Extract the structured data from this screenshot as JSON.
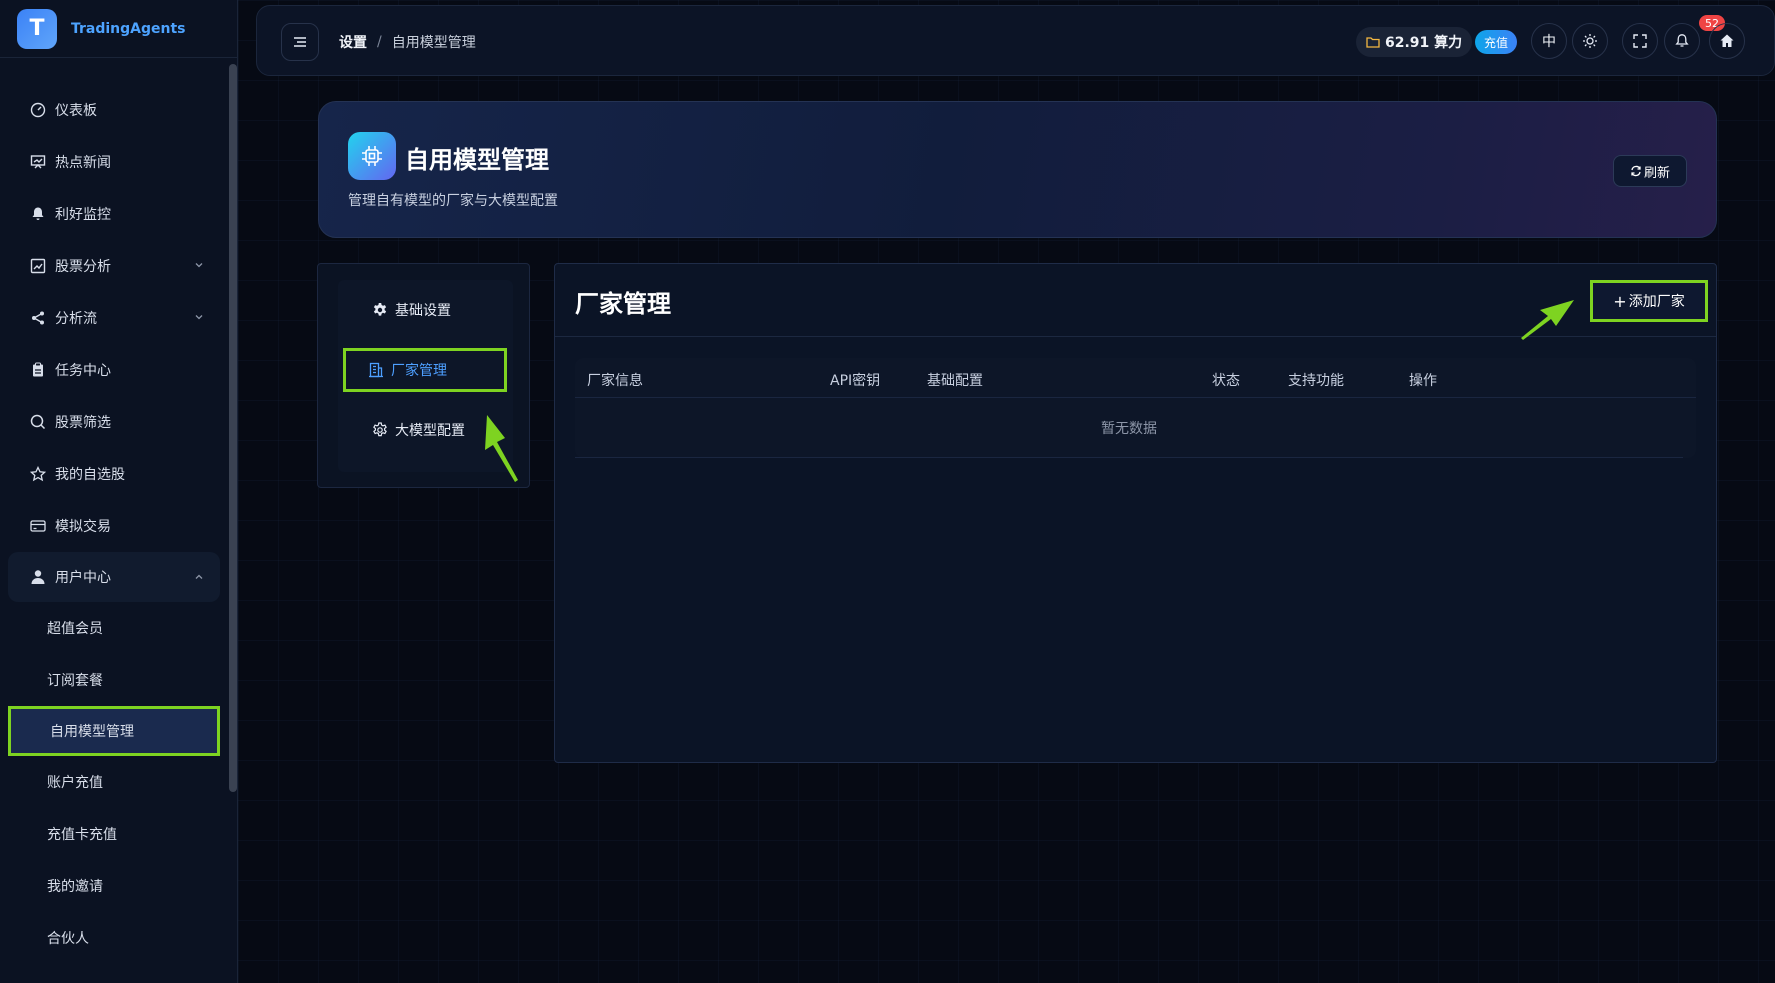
{
  "app": {
    "name": "TradingAgents",
    "logo_letter": "T"
  },
  "sidebar": {
    "items": [
      {
        "label": "仪表板",
        "icon": "gauge-icon"
      },
      {
        "label": "热点新闻",
        "icon": "presentation-icon"
      },
      {
        "label": "利好监控",
        "icon": "bell-icon"
      },
      {
        "label": "股票分析",
        "icon": "chart-icon"
      },
      {
        "label": "分析流",
        "icon": "share-icon"
      },
      {
        "label": "任务中心",
        "icon": "clipboard-icon"
      },
      {
        "label": "股票筛选",
        "icon": "search-icon"
      },
      {
        "label": "我的自选股",
        "icon": "star-icon"
      },
      {
        "label": "模拟交易",
        "icon": "card-icon"
      },
      {
        "label": "用户中心",
        "icon": "user-icon"
      }
    ],
    "sub_items": [
      "超值会员",
      "订阅套餐",
      "自用模型管理",
      "账户充值",
      "充值卡充值",
      "我的邀请",
      "合伙人"
    ]
  },
  "topbar": {
    "breadcrumb": [
      "设置",
      "自用模型管理"
    ],
    "separator": "/",
    "credits": "62.91 算力",
    "recharge_label": "充值",
    "lang_label": "中",
    "notification_count": "52"
  },
  "hero": {
    "title": "自用模型管理",
    "subtitle": "管理自有模型的厂家与大模型配置",
    "refresh_label": "刷新"
  },
  "tabs": [
    {
      "label": "基础设置",
      "icon": "gear-solid-icon"
    },
    {
      "label": "厂家管理",
      "icon": "building-icon"
    },
    {
      "label": "大模型配置",
      "icon": "gear-outline-icon"
    }
  ],
  "panel": {
    "title": "厂家管理",
    "add_label": "添加厂家",
    "columns": [
      "厂家信息",
      "API密钥",
      "基础配置",
      "状态",
      "支持功能",
      "操作"
    ],
    "empty_text": "暂无数据"
  },
  "colors": {
    "accent": "#4d9fff",
    "highlight": "#7ed321",
    "badge": "#ef4444"
  }
}
